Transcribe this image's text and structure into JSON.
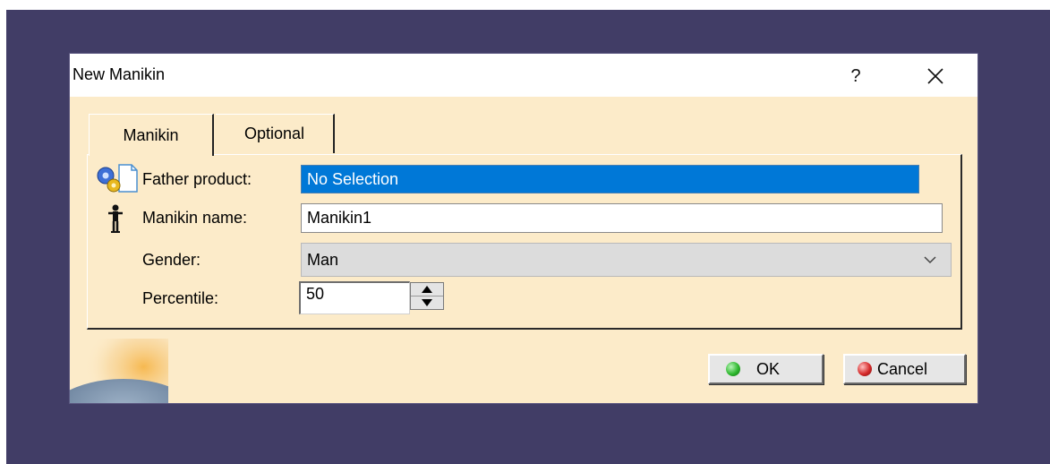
{
  "dialog": {
    "title": "New Manikin",
    "help_label": "?",
    "tabs": [
      {
        "label": "Manikin",
        "active": true
      },
      {
        "label": "Optional",
        "active": false
      }
    ],
    "father_product": {
      "label": "Father product:",
      "value": "No Selection"
    },
    "manikin_name": {
      "label": "Manikin name:",
      "value": "Manikin1"
    },
    "gender": {
      "label": "Gender:",
      "value": "Man"
    },
    "percentile": {
      "label": "Percentile:",
      "value": "50"
    },
    "buttons": {
      "ok": "OK",
      "cancel": "Cancel"
    }
  },
  "icons": {
    "father_product": "product-gears-icon",
    "manikin_name": "manikin-figure-icon",
    "close": "close-icon",
    "dropdown": "chevron-down-icon",
    "spin_up": "arrow-up-icon",
    "spin_down": "arrow-down-icon",
    "ok": "green-led-icon",
    "cancel": "red-led-icon",
    "decoration": "globe-icon"
  },
  "colors": {
    "desktop": "#413d66",
    "dialog_background": "#fcebc9",
    "selection": "#0078d7",
    "ok_led": "#2fb82f",
    "cancel_led": "#d52a2a"
  }
}
